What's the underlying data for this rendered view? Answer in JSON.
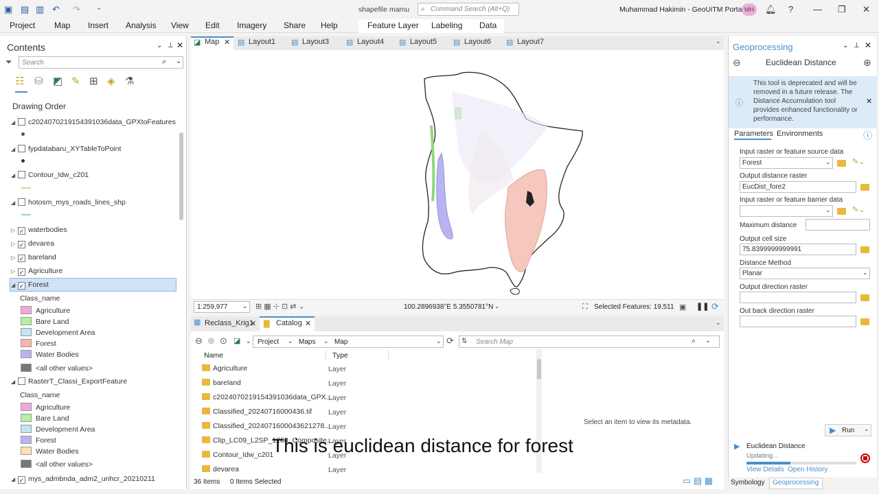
{
  "app": {
    "doc_title": "shapefile mamu",
    "command_search_placeholder": "Command Search (Alt+Q)",
    "user": "Muhammad Hakimin - GeoUiTM Portal",
    "user_initials": "MH"
  },
  "ribbon": {
    "tabs": [
      "Project",
      "Map",
      "Insert",
      "Analysis",
      "View",
      "Edit",
      "Imagery",
      "Share",
      "Help",
      "Feature Layer",
      "Labeling",
      "Data"
    ]
  },
  "contents": {
    "title": "Contents",
    "search_placeholder": "Search",
    "drawing_order": "Drawing Order",
    "layers": [
      {
        "name": "c20240702191543910​36data_GPXtoFeatures",
        "checked": false
      },
      {
        "name": "fypdatabaru_XYTableToPoint",
        "checked": false
      },
      {
        "name": "Contour_Idw_c201",
        "checked": false
      },
      {
        "name": "hotosm_mys_roads_lines_shp",
        "checked": false
      },
      {
        "name": "waterbodies",
        "checked": true
      },
      {
        "name": "devarea",
        "checked": true
      },
      {
        "name": "bareland",
        "checked": true
      },
      {
        "name": "Agriculture",
        "checked": true
      },
      {
        "name": "Forest",
        "checked": true
      }
    ],
    "class_name_label": "Class_name",
    "forest_legend": [
      "Agriculture",
      "Bare Land",
      "Development Area",
      "Forest",
      "Water Bodies",
      "<all other values>"
    ],
    "raster_layer": "RasterT_Classi_ExportFeature",
    "raster_legend": [
      "Agriculture",
      "Bare Land",
      "Development Area",
      "Forest",
      "Water Bodies",
      "<all other values>"
    ],
    "last_layer": "mys_admbnda_adm2_unhcr_20210211"
  },
  "map": {
    "tabs": [
      "Map",
      "Layout1",
      "Layout3",
      "Layout4",
      "Layout5",
      "Layout6",
      "Layout7"
    ],
    "scale": "1:259,977",
    "coords": "100.2896938°E 5.3550781°N",
    "selected_features": "Selected Features: 19,511"
  },
  "catalog": {
    "tabs": [
      "Reclass_Krig1",
      "Catalog"
    ],
    "breadcrumb": [
      "Project",
      "Maps",
      "Map"
    ],
    "search_placeholder": "Search Map",
    "col_name": "Name",
    "col_type": "Type",
    "items": [
      {
        "name": "Agriculture",
        "type": "Layer"
      },
      {
        "name": "bareland",
        "type": "Layer"
      },
      {
        "name": "c20240702191543910​36data_GPX...",
        "type": "Layer"
      },
      {
        "name": "Classified_20240716000436.tif",
        "type": "Layer"
      },
      {
        "name": "Classified_20240716000436212​78...",
        "type": "Layer"
      },
      {
        "name": "Clip_LC09_L2SP_1280_Composite...",
        "type": "Layer"
      },
      {
        "name": "Contour_Idw_c201",
        "type": "Layer"
      },
      {
        "name": "devarea",
        "type": "Layer"
      }
    ],
    "metadata_msg": "Select an item to view its metadata.",
    "items_count": "36 Items",
    "items_selected": "0 Items Selected"
  },
  "geo": {
    "title": "Geoprocessing",
    "tool": "Euclidean Distance",
    "notice": "This tool is deprecated and will be removed in a future release. The Distance Accumulation tool provides enhanced functionality or performance.",
    "tab_params": "Parameters",
    "tab_env": "Environments",
    "params": {
      "input_label": "Input raster or feature source data",
      "input_value": "Forest",
      "output_label": "Output distance raster",
      "output_value": "EucDist_fore2",
      "barrier_label": "Input raster or feature barrier data",
      "maxdist_label": "Maximum distance",
      "cell_label": "Output cell size",
      "cell_value": "75.8399999999991",
      "method_label": "Distance Method",
      "method_value": "Planar",
      "dir_label": "Output direction raster",
      "back_label": "Out back direction raster"
    },
    "run": "Run",
    "status_tool": "Euclidean Distance",
    "status_updating": "Updating...",
    "view_details": "View Details",
    "open_history": "Open History",
    "bottom_tabs": [
      "Symbology",
      "Geoprocessing"
    ]
  },
  "caption": "This is euclidean distance for forest",
  "colors": {
    "agriculture": "#f2a7d8",
    "bareland": "#b3f0a0",
    "development": "#bfe6f5",
    "forest": "#f5b7a8",
    "water": "#b9b3f0",
    "other": "#777777",
    "accent": "#4a8ec9"
  }
}
